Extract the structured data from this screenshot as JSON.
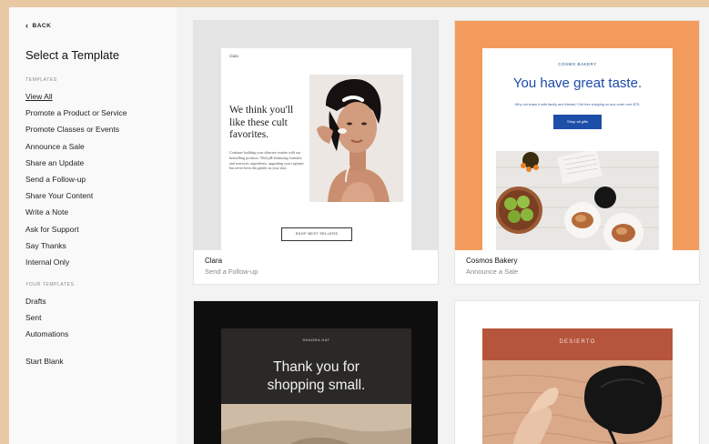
{
  "sidebar": {
    "back_label": "BACK",
    "title": "Select a Template",
    "templates_section": "TEMPLATES",
    "templates": [
      {
        "label": "View All",
        "active": true
      },
      {
        "label": "Promote a Product or Service"
      },
      {
        "label": "Promote Classes or Events"
      },
      {
        "label": "Announce a Sale"
      },
      {
        "label": "Share an Update"
      },
      {
        "label": "Send a Follow-up"
      },
      {
        "label": "Share Your Content"
      },
      {
        "label": "Write a Note"
      },
      {
        "label": "Ask for Support"
      },
      {
        "label": "Say Thanks"
      },
      {
        "label": "Internal Only"
      }
    ],
    "your_templates_section": "YOUR TEMPLATES",
    "your_templates": [
      {
        "label": "Drafts"
      },
      {
        "label": "Sent"
      },
      {
        "label": "Automations"
      }
    ],
    "start_blank": "Start Blank"
  },
  "cards": [
    {
      "name": "Clara",
      "category": "Send a Follow-up",
      "brand": "clara",
      "headline": "We think you'll like these cult favorites.",
      "body": "Continue building your skincare routine with our bestselling products. With pH-balancing formulas and non-toxic ingredients, upgrading your regimen has never been this gentle on your skin.",
      "cta": "SHOP BEST SELLERS"
    },
    {
      "name": "Cosmos Bakery",
      "category": "Announce a Sale",
      "brand": "COSMO BAKERY",
      "headline": "You have great taste.",
      "subtext": "Why not share it with family and friends? Get free shipping on any order over $75.",
      "cta": "Shop all gifts"
    },
    {
      "brand": "SHADRA HAT",
      "headline_line1": "Thank you for",
      "headline_line2": "shopping small."
    },
    {
      "brand": "DESIERTO"
    }
  ],
  "colors": {
    "cosmos_bg": "#f29b5c",
    "cosmos_blue": "#1e4fa8",
    "desierto_header": "#b5553b"
  }
}
